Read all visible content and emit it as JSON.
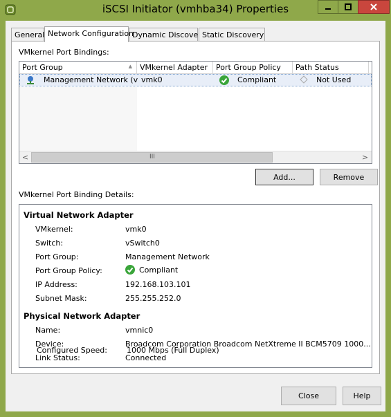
{
  "window": {
    "title": "iSCSI Initiator (vmhba34) Properties",
    "controls": {
      "minimize": "—",
      "maximize": "☐",
      "close": "✕"
    }
  },
  "tabs": [
    {
      "label": "General"
    },
    {
      "label": "Network Configuration"
    },
    {
      "label": "Dynamic Discovery"
    },
    {
      "label": "Static Discovery"
    }
  ],
  "bindings": {
    "label": "VMkernel Port Bindings:",
    "columns": [
      "Port Group",
      "VMkernel Adapter",
      "Port Group Policy",
      "Path Status"
    ],
    "sort_indicator": "▲",
    "rows": [
      {
        "port_group": "Management Network (v...",
        "vmkernel_adapter": "vmk0",
        "policy": "Compliant",
        "path_status": "Not Used"
      }
    ],
    "scroll": {
      "left": "<",
      "right": ">",
      "grip": "III"
    }
  },
  "buttons": {
    "add": "Add...",
    "remove": "Remove",
    "close": "Close",
    "help": "Help"
  },
  "details": {
    "label": "VMkernel Port Binding Details:",
    "virtual": {
      "heading": "Virtual Network Adapter",
      "vmkernel_k": "VMkernel:",
      "vmkernel_v": "vmk0",
      "switch_k": "Switch:",
      "switch_v": "vSwitch0",
      "portgroup_k": "Port Group:",
      "portgroup_v": "Management Network",
      "policy_k": "Port Group Policy:",
      "policy_v": "Compliant",
      "ip_k": "IP Address:",
      "ip_v": "192.168.103.101",
      "mask_k": "Subnet Mask:",
      "mask_v": "255.255.252.0"
    },
    "physical": {
      "heading": "Physical Network Adapter",
      "name_k": "Name:",
      "name_v": "vmnic0",
      "device_k": "Device:",
      "device_v": "Broadcom Corporation Broadcom NetXtreme II BCM5709 1000...",
      "link_k": "Link Status:",
      "link_v": "Connected",
      "speed_k": "Configured Speed:",
      "speed_v": "1000 Mbps (Full Duplex)"
    }
  },
  "colors": {
    "titlebar": "#8fa84a",
    "close_button": "#c9463d",
    "compliant": "#3aa53a",
    "row_selected": "#e8eef8"
  }
}
